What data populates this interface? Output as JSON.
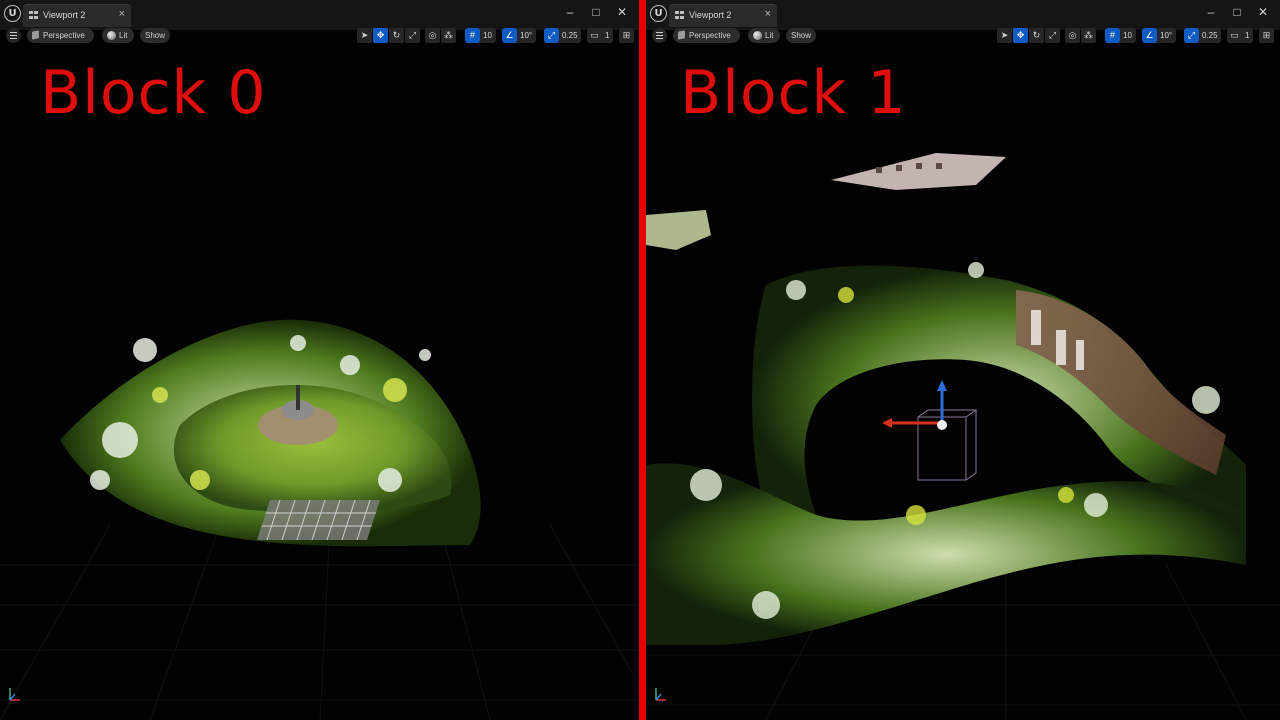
{
  "viewports": [
    {
      "tab_title": "Viewport 2",
      "toolbar": {
        "perspective_label": "Perspective",
        "lit_label": "Lit",
        "show_label": "Show",
        "grid_snap": "10",
        "rotation_snap": "10°",
        "scale_snap": "0.25",
        "camera_speed": "1"
      },
      "overlay_label": "Block 0"
    },
    {
      "tab_title": "Viewport 2",
      "toolbar": {
        "perspective_label": "Perspective",
        "lit_label": "Lit",
        "show_label": "Show",
        "grid_snap": "10",
        "rotation_snap": "10°",
        "scale_snap": "0.25",
        "camera_speed": "1"
      },
      "overlay_label": "Block 1"
    }
  ],
  "colors": {
    "overlay_label": "#e00d0d",
    "divider": "#e60000",
    "active_tool": "#0f5bc4"
  },
  "icons": {
    "window_controls": [
      "minimize-icon",
      "maximize-icon",
      "close-icon"
    ],
    "transform_tools": [
      "select-icon",
      "translate-icon",
      "rotate-icon",
      "scale-icon"
    ]
  }
}
